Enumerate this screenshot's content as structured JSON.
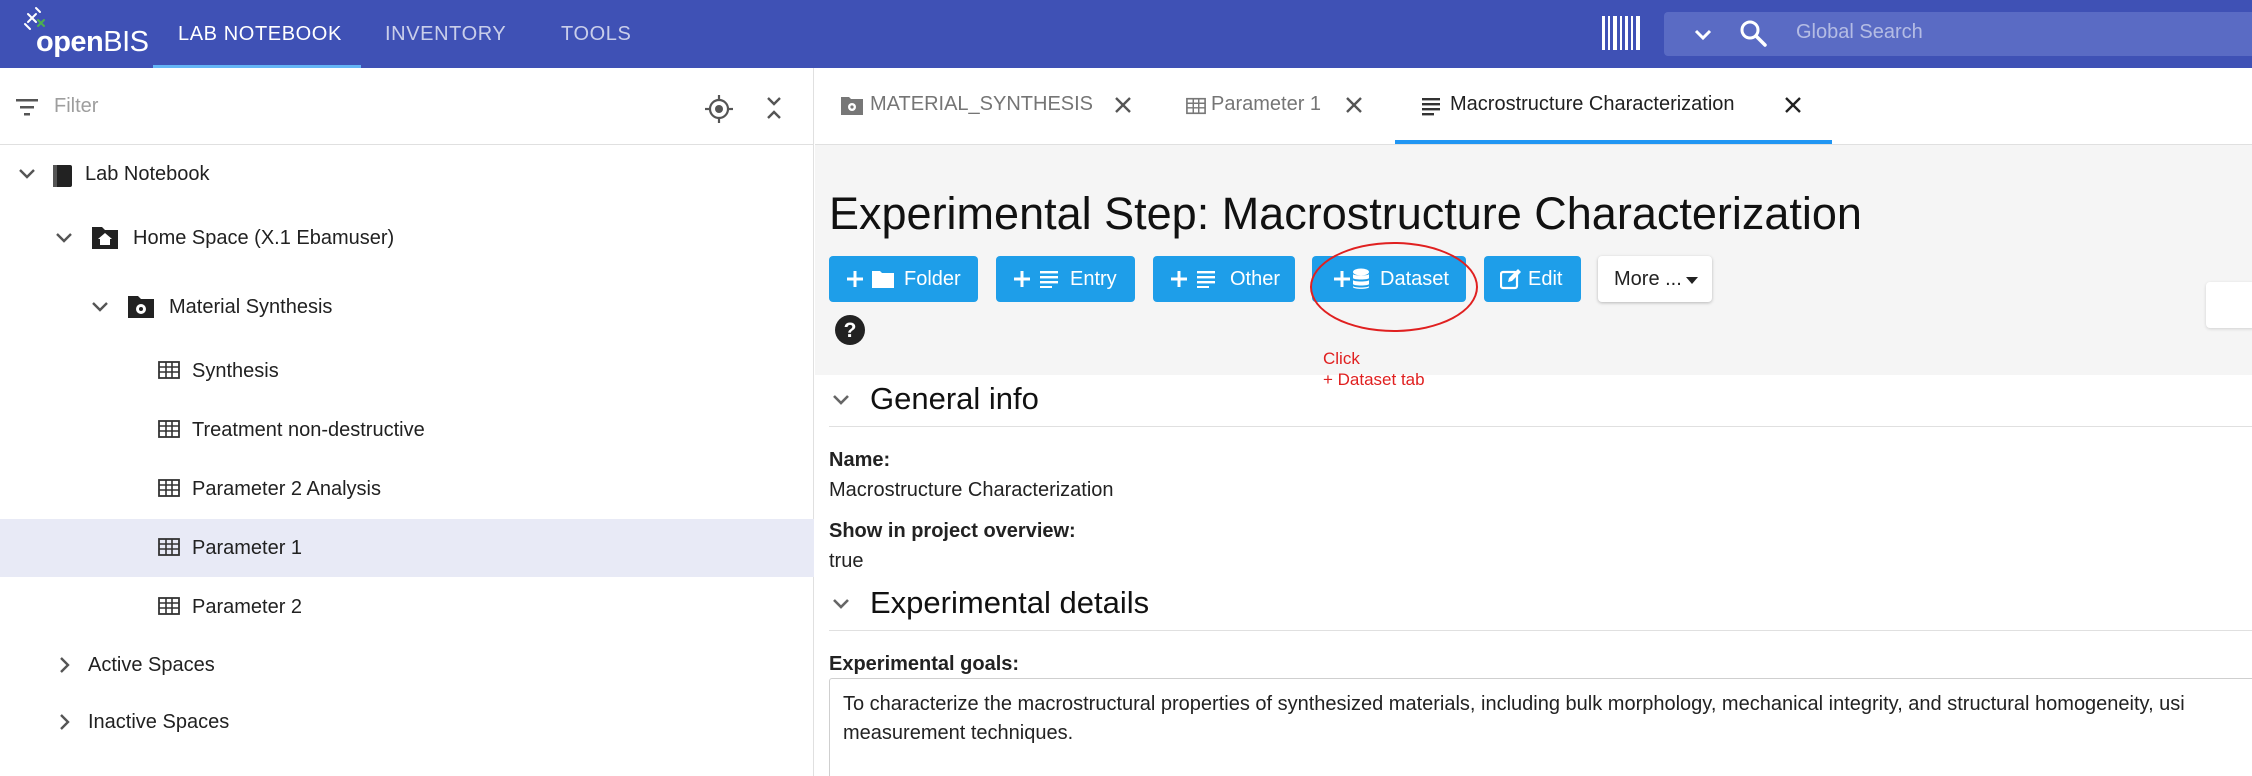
{
  "app": {
    "logo_text_bold": "open",
    "logo_text_light": "BIS"
  },
  "topnav": {
    "tabs": [
      {
        "label": "LAB NOTEBOOK",
        "active": true
      },
      {
        "label": "INVENTORY",
        "active": false
      },
      {
        "label": "TOOLS",
        "active": false
      }
    ],
    "barcode_icon": "barcode-icon",
    "search": {
      "placeholder": "Global Search",
      "icon": "search-icon"
    }
  },
  "sidebar": {
    "filter_placeholder": "Filter",
    "tree": [
      {
        "label": "Lab Notebook",
        "icon": "notebook-icon",
        "expanded": true
      },
      {
        "label": "Home Space (X.1 Ebamuser)",
        "icon": "home-icon",
        "expanded": true
      },
      {
        "label": "Material Synthesis",
        "icon": "folder-gear-icon",
        "expanded": true
      },
      {
        "label": "Synthesis",
        "icon": "table-icon"
      },
      {
        "label": "Treatment non-destructive",
        "icon": "table-icon"
      },
      {
        "label": "Parameter 2 Analysis",
        "icon": "table-icon"
      },
      {
        "label": "Parameter 1",
        "icon": "table-icon",
        "selected": true
      },
      {
        "label": "Parameter 2",
        "icon": "table-icon"
      },
      {
        "label": "Active Spaces",
        "expanded": false
      },
      {
        "label": "Inactive Spaces",
        "expanded": false
      }
    ]
  },
  "tabs": [
    {
      "label": "MATERIAL_SYNTHESIS",
      "icon": "folder-gear-icon",
      "active": false
    },
    {
      "label": "Parameter 1",
      "icon": "table-icon",
      "active": false
    },
    {
      "label": "Macrostructure Characterization",
      "icon": "lines-icon",
      "active": true
    }
  ],
  "page": {
    "title": "Experimental Step: Macrostructure Characterization",
    "buttons": {
      "folder": "Folder",
      "entry": "Entry",
      "other": "Other",
      "dataset": "Dataset",
      "edit": "Edit",
      "more": "More ..."
    },
    "annotation": {
      "line1": "Click",
      "line2": "+ Dataset tab",
      "color": "#e02020"
    },
    "sections": {
      "general_info": "General info",
      "experimental_details": "Experimental details"
    },
    "fields": {
      "name_label": "Name:",
      "name_value": "Macrostructure Characterization",
      "overview_label": "Show in project overview:",
      "overview_value": "true",
      "goals_label": "Experimental goals:",
      "goals_value": "To characterize the macrostructural properties of synthesized materials, including bulk morphology, mechanical integrity, and structural homogeneity, usi measurement techniques."
    }
  },
  "colors": {
    "topbar": "#3f51b5",
    "accent": "#1e9ee9",
    "selected_row": "#e8eaf6"
  }
}
